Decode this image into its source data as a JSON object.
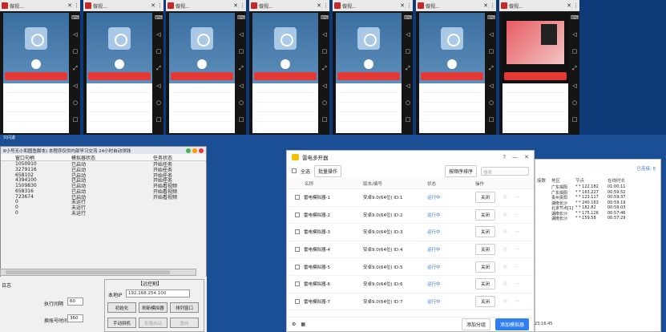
{
  "tiles": [
    {
      "title": "做视..."
    },
    {
      "title": "做视..."
    },
    {
      "title": "做视..."
    },
    {
      "title": "做视..."
    },
    {
      "title": "做视..."
    },
    {
      "title": "做视..."
    },
    {
      "title": "做视..."
    }
  ],
  "status_label": "只闪退",
  "script_window": {
    "title": "8小号无小和圆鱼脚本) 本程序仅供内部学习交流 24小时自动领钱",
    "columns": [
      "窗口句柄",
      "模拟器状态",
      "任务状态"
    ],
    "rows": [
      [
        "1050910",
        "已启动",
        "开始任务"
      ],
      [
        "3279116",
        "已启动",
        "开始任务"
      ],
      [
        "658102",
        "已启动",
        "开始任务"
      ],
      [
        "4394100",
        "已启动",
        "开始任务"
      ],
      [
        "1509830",
        "已启动",
        "开始看视频"
      ],
      [
        "658316",
        "已启动",
        "开始看视频"
      ],
      [
        "723674",
        "已启动",
        "开始看视频"
      ],
      [
        "0",
        "未运行",
        ""
      ],
      [
        "0",
        "未运行",
        ""
      ],
      [
        "0",
        "未运行",
        ""
      ]
    ],
    "log_label": "日志",
    "interval_label": "执行间隔",
    "interval_value": "60",
    "account_time_label": "换账号时间",
    "account_time_value": "360",
    "group_title": "【远控割】",
    "local_label": "本地IP",
    "local_value": "192.168.254.100",
    "buttons": [
      "初始化",
      "刷新模拟器",
      "排列窗口",
      "手动拼机",
      "批量启动",
      "重启"
    ]
  },
  "manager": {
    "title": "雷电多开器",
    "select_all": "全选",
    "batch_label": "批量操作",
    "sort_label": "按顺序排序",
    "search_placeholder": "搜索",
    "columns": [
      "名称",
      "版本/编号",
      "状态",
      "操作"
    ],
    "rows": [
      {
        "name": "雷电模拟器-1",
        "ver": "安卓9.0(64位)  ID:1",
        "status": "运行中",
        "action": "关闭"
      },
      {
        "name": "雷电模拟器-2",
        "ver": "安卓9.0(64位)  ID:2",
        "status": "运行中",
        "action": "关闭"
      },
      {
        "name": "雷电模拟器-3",
        "ver": "安卓9.0(64位)  ID:3",
        "status": "运行中",
        "action": "关闭"
      },
      {
        "name": "雷电模拟器-4",
        "ver": "安卓9.0(64位)  ID:4",
        "status": "运行中",
        "action": "关闭"
      },
      {
        "name": "雷电模拟器-5",
        "ver": "安卓9.0(64位)  ID:5",
        "status": "运行中",
        "action": "关闭"
      },
      {
        "name": "雷电模拟器-6",
        "ver": "安卓9.0(64位)  ID:6",
        "status": "运行中",
        "action": "关闭"
      },
      {
        "name": "雷电模拟器-7",
        "ver": "安卓9.0(64位)  ID:7",
        "status": "运行中",
        "action": "关闭"
      }
    ],
    "add_group": "添加分组",
    "add_emulator": "添加模拟器"
  },
  "right_window": {
    "status": "已连接: 8",
    "columns": [
      "接数",
      "地区",
      "节点",
      "在线时长"
    ],
    "rows": [
      [
        "",
        "广东揭阳",
        "* * 122.182",
        "01:00:11"
      ],
      [
        "",
        "广东揭阳",
        "* * 163.227",
        "00:59:52"
      ],
      [
        "",
        "贵州贵阳",
        "* * 123.117",
        "00:59:37"
      ],
      [
        "",
        "湖南长沙",
        "* * 240.163",
        "00:59:19"
      ],
      [
        "",
        "北京节点[1]",
        "* * 182.82",
        "00:59:03"
      ],
      [
        "",
        "湖南长沙",
        "* * 175.126",
        "00:57:46"
      ],
      [
        "",
        "湖南长沙",
        "* * 159.58",
        "00:57:29"
      ]
    ],
    "time": "23:16:45"
  }
}
